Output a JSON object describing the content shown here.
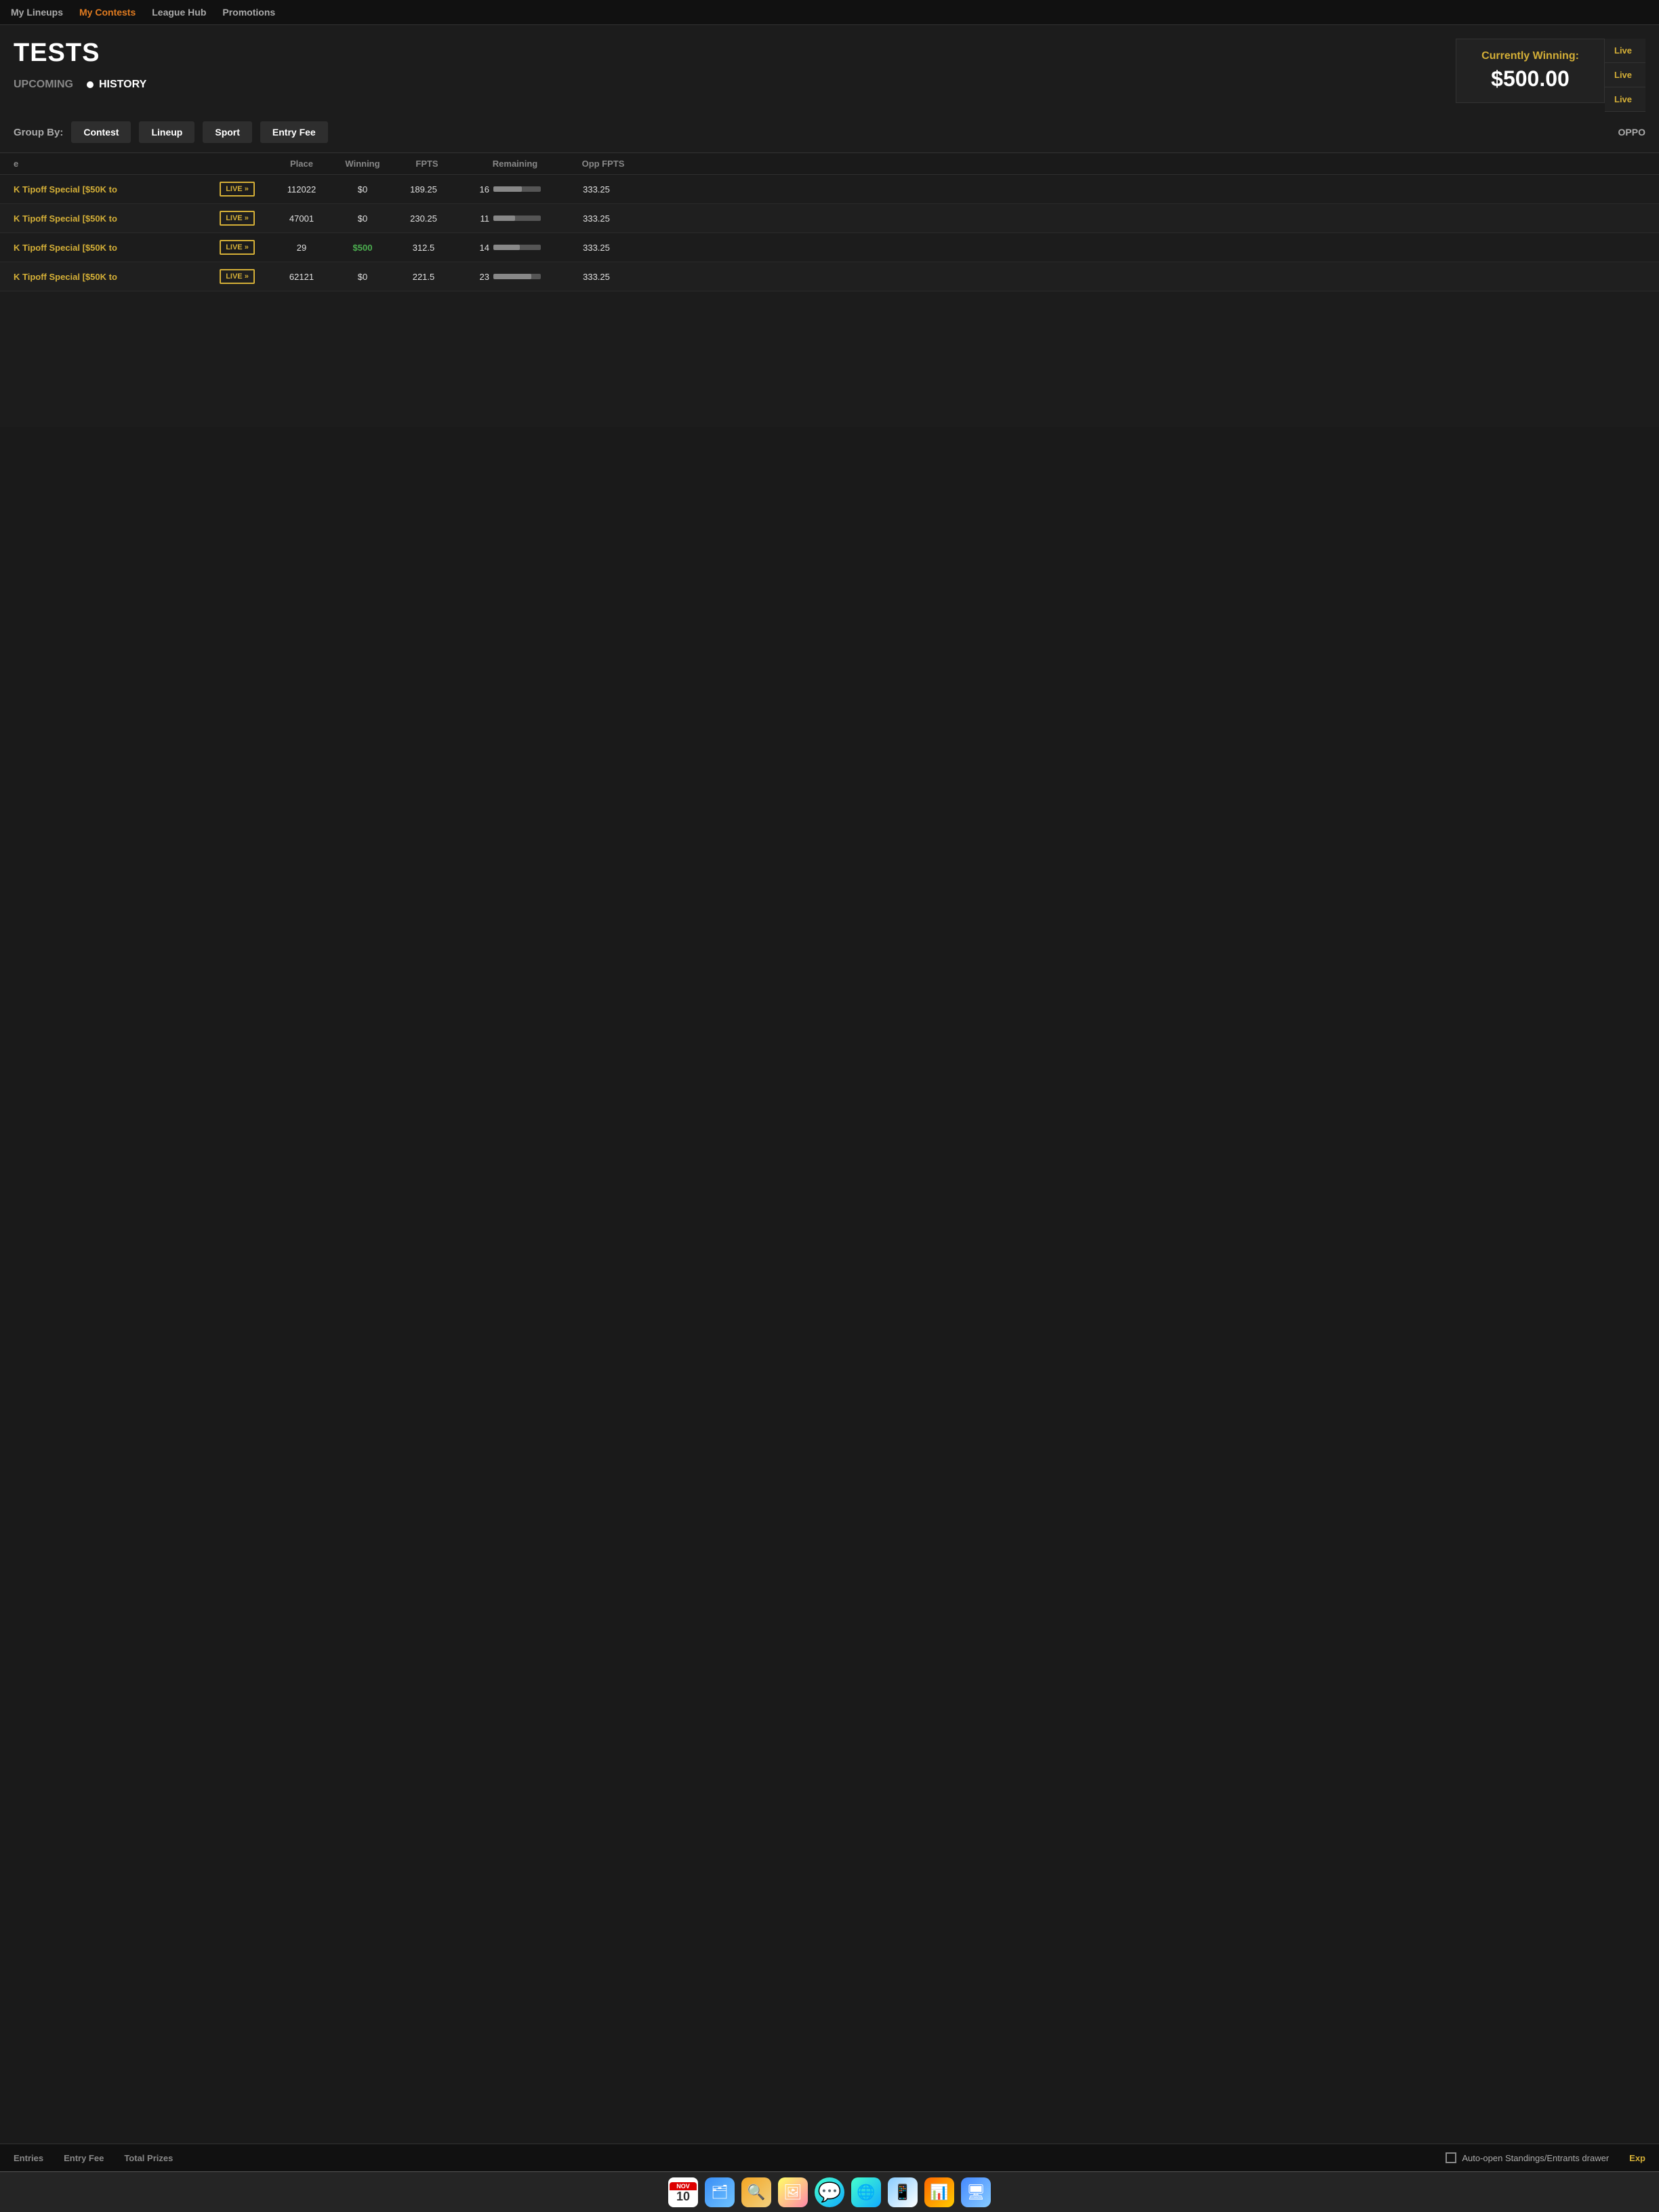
{
  "nav": {
    "items": [
      {
        "label": "My Lineups",
        "active": false
      },
      {
        "label": "My Contests",
        "active": true
      },
      {
        "label": "League Hub",
        "active": false
      },
      {
        "label": "Promotions",
        "active": false
      }
    ]
  },
  "page": {
    "title": "TESTS",
    "tabs": {
      "upcoming": "UPCOMING",
      "history": "HISTORY"
    }
  },
  "winning": {
    "label": "Currently Winning:",
    "amount": "$500.00"
  },
  "live_side": {
    "buttons": [
      "Live",
      "Live",
      "Live"
    ]
  },
  "groupby": {
    "label": "Group By:",
    "buttons": [
      "Contest",
      "Lineup",
      "Sport",
      "Entry Fee"
    ],
    "opp_label": "OPPO"
  },
  "table": {
    "headers": [
      "e",
      "",
      "Place",
      "Winning",
      "FPTS",
      "Remaining",
      "Opp FPTS"
    ],
    "rows": [
      {
        "name": "K Tipoff Special [$50K to",
        "status": "LIVE »",
        "place": "112022",
        "winning": "$0",
        "fpts": "189.25",
        "remaining_num": "16",
        "remaining_pct": 60,
        "opp_fpts": "333.25",
        "winning_highlight": false
      },
      {
        "name": "K Tipoff Special [$50K to",
        "status": "LIVE »",
        "place": "47001",
        "winning": "$0",
        "fpts": "230.25",
        "remaining_num": "11",
        "remaining_pct": 45,
        "opp_fpts": "333.25",
        "winning_highlight": false
      },
      {
        "name": "K Tipoff Special [$50K to",
        "status": "LIVE »",
        "place": "29",
        "winning": "$500",
        "fpts": "312.5",
        "remaining_num": "14",
        "remaining_pct": 55,
        "opp_fpts": "333.25",
        "winning_highlight": true
      },
      {
        "name": "K Tipoff Special [$50K to",
        "status": "LIVE »",
        "place": "62121",
        "winning": "$0",
        "fpts": "221.5",
        "remaining_num": "23",
        "remaining_pct": 80,
        "opp_fpts": "333.25",
        "winning_highlight": false
      }
    ]
  },
  "footer": {
    "entries_label": "Entries",
    "entry_fee_label": "Entry Fee",
    "total_prizes_label": "Total Prizes",
    "auto_open_label": "Auto-open Standings/Entrants drawer",
    "exp_label": "Exp"
  },
  "dock": {
    "cal_month": "NOV",
    "cal_day": "10"
  },
  "colors": {
    "accent_yellow": "#d4af37",
    "accent_green": "#4caf50",
    "accent_orange": "#e07b20",
    "bg_dark": "#1a1a1a",
    "bg_medium": "#1c1c1c"
  }
}
